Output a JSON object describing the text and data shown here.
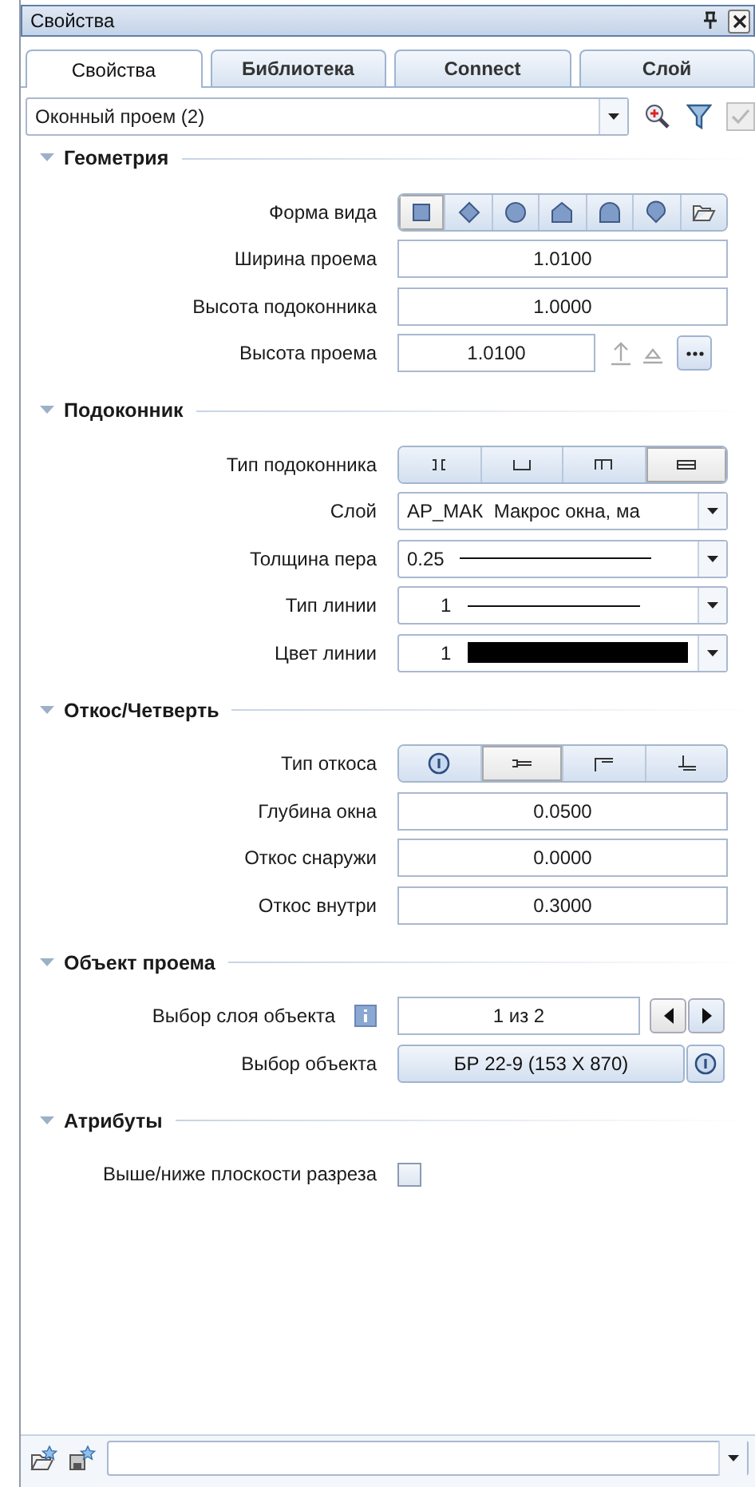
{
  "window": {
    "title": "Свойства"
  },
  "tabs": [
    {
      "label": "Свойства",
      "selected": true
    },
    {
      "label": "Библиотека",
      "selected": false
    },
    {
      "label": "Connect",
      "selected": false
    },
    {
      "label": "Слой",
      "selected": false
    }
  ],
  "object_selector": {
    "value": "Оконный проем (2)",
    "apply_enabled": false
  },
  "sections": [
    {
      "title": "Геометрия",
      "expanded": true,
      "rows": [
        {
          "kind": "segmented",
          "label": "Форма вида",
          "options": [
            {
              "selected": true
            },
            {
              "selected": false
            },
            {
              "selected": false
            },
            {
              "selected": false
            },
            {
              "selected": false
            },
            {
              "selected": false
            },
            {
              "selected": false
            }
          ]
        },
        {
          "kind": "number",
          "label": "Ширина проема",
          "value": "1.0100"
        },
        {
          "kind": "number",
          "label": "Высота подоконника",
          "value": "1.0000"
        },
        {
          "kind": "number_tools",
          "label": "Высота проема",
          "value": "1.0100"
        }
      ]
    },
    {
      "title": "Подоконник",
      "expanded": true,
      "rows": [
        {
          "kind": "segmented",
          "label": "Тип подоконника",
          "options": [
            {
              "selected": false
            },
            {
              "selected": false
            },
            {
              "selected": false
            },
            {
              "selected": true
            }
          ]
        },
        {
          "kind": "dropdown",
          "label": "Слой",
          "value": "АР_МАК  Макрос окна, ма"
        },
        {
          "kind": "pen",
          "label": "Толщина пера",
          "value": "0.25"
        },
        {
          "kind": "linetype",
          "label": "Тип линии",
          "value": "1"
        },
        {
          "kind": "color",
          "label": "Цвет линии",
          "value": "1"
        }
      ]
    },
    {
      "title": "Откос/Четверть",
      "expanded": true,
      "rows": [
        {
          "kind": "segmented",
          "label": "Тип откоса",
          "options": [
            {
              "selected": false
            },
            {
              "selected": true
            },
            {
              "selected": false
            },
            {
              "selected": false
            }
          ]
        },
        {
          "kind": "number",
          "label": "Глубина окна",
          "value": "0.0500"
        },
        {
          "kind": "number",
          "label": "Откос снаружи",
          "value": "0.0000"
        },
        {
          "kind": "number",
          "label": "Откос внутри",
          "value": "0.3000"
        }
      ]
    },
    {
      "title": "Объект проема",
      "expanded": true,
      "rows": [
        {
          "kind": "stepper",
          "label": "Выбор слоя объекта",
          "value": "1 из 2"
        },
        {
          "kind": "object_button",
          "label": "Выбор объекта",
          "value": "БР 22-9 (153 X 870)"
        }
      ]
    },
    {
      "title": "Атрибуты",
      "expanded": true,
      "rows": [
        {
          "kind": "checkbox",
          "label": "Выше/ниже плоскости разреза",
          "checked": false
        }
      ]
    }
  ]
}
